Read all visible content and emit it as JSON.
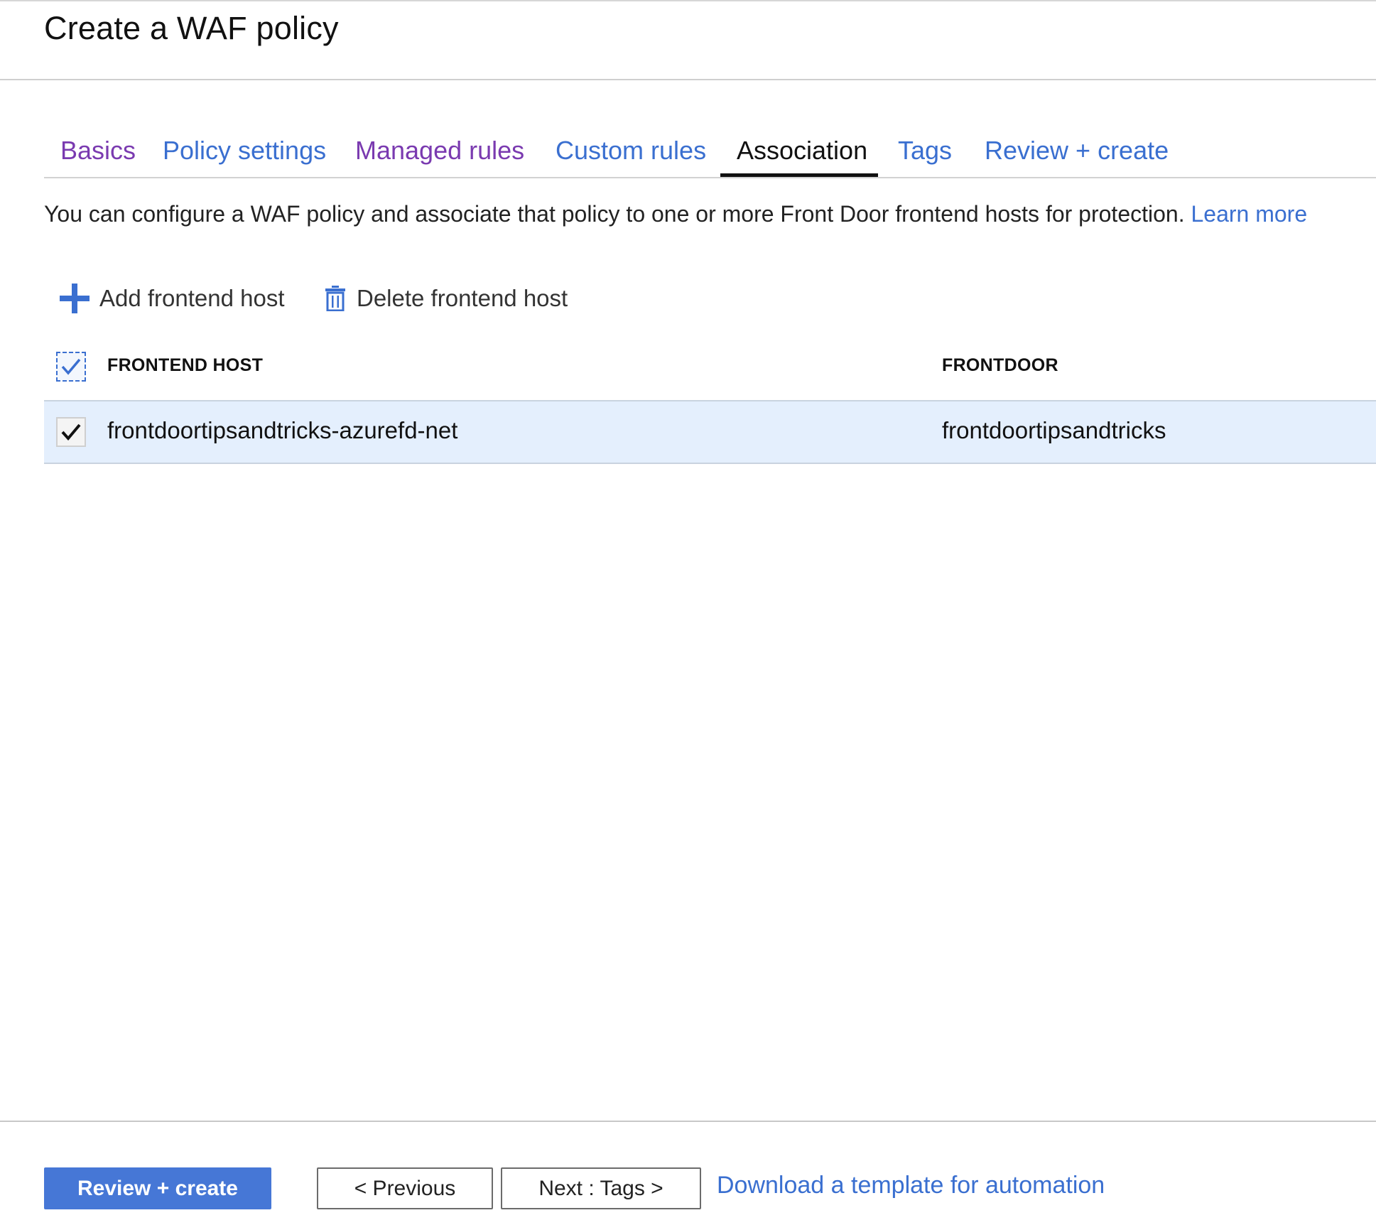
{
  "page": {
    "title": "Create a WAF policy"
  },
  "tabs": [
    {
      "label": "Basics",
      "state": "visited"
    },
    {
      "label": "Policy settings",
      "state": "link"
    },
    {
      "label": "Managed rules",
      "state": "visited"
    },
    {
      "label": "Custom rules",
      "state": "link"
    },
    {
      "label": "Association",
      "state": "active"
    },
    {
      "label": "Tags",
      "state": "link"
    },
    {
      "label": "Review + create",
      "state": "link"
    }
  ],
  "description": {
    "text": "You can configure a WAF policy and associate that policy to one or more Front Door frontend hosts for protection.",
    "link_label": "Learn more"
  },
  "toolbar": {
    "add_label": "Add frontend host",
    "add_icon": "plus-icon",
    "delete_label": "Delete frontend host",
    "delete_icon": "trash-icon"
  },
  "table": {
    "header_checked": true,
    "columns": [
      "FRONTEND HOST",
      "FRONTDOOR"
    ],
    "rows": [
      {
        "frontend_host": "frontdoortipsandtricks-azurefd-net",
        "frontdoor": "frontdoortipsandtricks",
        "checked": true
      }
    ]
  },
  "footer": {
    "primary_label": "Review + create",
    "previous_label": "< Previous",
    "next_label": "Next : Tags >",
    "download_label": "Download a template for automation"
  },
  "colors": {
    "accent": "#4677d6",
    "link": "#3a6fd0",
    "visited": "#7a3ab0",
    "selected_row": "#e4effd"
  }
}
